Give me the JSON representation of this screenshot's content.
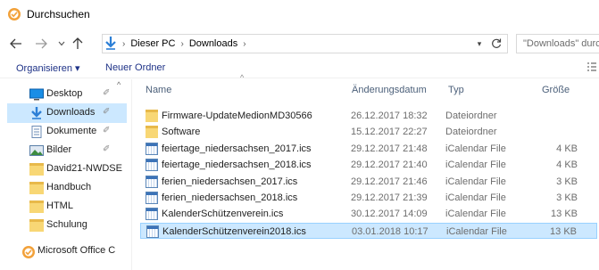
{
  "window": {
    "title": "Durchsuchen",
    "accent": "#0078d7"
  },
  "nav": {
    "back_icon": "back-arrow-icon",
    "forward_icon": "forward-arrow-icon",
    "recent_icon": "chevron-down-icon",
    "up_icon": "up-arrow-icon"
  },
  "address": {
    "crumbs": [
      "Dieser PC",
      "Downloads"
    ],
    "search_placeholder": "\"Downloads\" durchsuchen"
  },
  "toolbar": {
    "organize": "Organisieren ▾",
    "new_folder": "Neuer Ordner"
  },
  "sidebar": {
    "items": [
      {
        "label": "Desktop",
        "icon": "desktop-icon",
        "pinned": true
      },
      {
        "label": "Downloads",
        "icon": "download-arrow-icon",
        "pinned": true,
        "selected": true
      },
      {
        "label": "Dokumente",
        "icon": "document-icon",
        "pinned": true
      },
      {
        "label": "Bilder",
        "icon": "pictures-icon",
        "pinned": true
      },
      {
        "label": "David21-NWDSE",
        "icon": "folder-icon"
      },
      {
        "label": "Handbuch",
        "icon": "folder-icon"
      },
      {
        "label": "HTML",
        "icon": "folder-icon"
      },
      {
        "label": "Schulung",
        "icon": "folder-icon"
      },
      {
        "label": "Microsoft Office C",
        "icon": "office-icon"
      }
    ]
  },
  "columns": {
    "name": "Name",
    "date": "Änderungsdatum",
    "type": "Typ",
    "size": "Größe"
  },
  "files": [
    {
      "name": "Firmware-UpdateMedionMD30566",
      "date": "26.12.2017 18:32",
      "type": "Dateiordner",
      "size": "",
      "kind": "folder"
    },
    {
      "name": "Software",
      "date": "15.12.2017 22:27",
      "type": "Dateiordner",
      "size": "",
      "kind": "folder"
    },
    {
      "name": "feiertage_niedersachsen_2017.ics",
      "date": "29.12.2017 21:48",
      "type": "iCalendar File",
      "size": "4 KB",
      "kind": "ics"
    },
    {
      "name": "feiertage_niedersachsen_2018.ics",
      "date": "29.12.2017 21:40",
      "type": "iCalendar File",
      "size": "4 KB",
      "kind": "ics"
    },
    {
      "name": "ferien_niedersachsen_2017.ics",
      "date": "29.12.2017 21:46",
      "type": "iCalendar File",
      "size": "3 KB",
      "kind": "ics"
    },
    {
      "name": "ferien_niedersachsen_2018.ics",
      "date": "29.12.2017 21:39",
      "type": "iCalendar File",
      "size": "3 KB",
      "kind": "ics"
    },
    {
      "name": "KalenderSchützenverein.ics",
      "date": "30.12.2017 14:09",
      "type": "iCalendar File",
      "size": "13 KB",
      "kind": "ics"
    },
    {
      "name": "KalenderSchützenverein2018.ics",
      "date": "03.01.2018 10:17",
      "type": "iCalendar File",
      "size": "13 KB",
      "kind": "ics",
      "selected": true
    }
  ]
}
